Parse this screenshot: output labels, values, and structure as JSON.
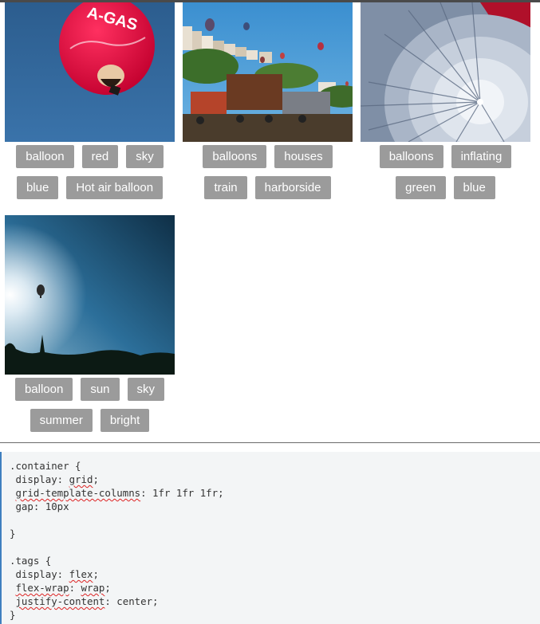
{
  "gallery": {
    "items": [
      {
        "image": "hot-air-balloon-closeup",
        "image_text": "A-GAS",
        "tags": [
          "balloon",
          "red",
          "sky",
          "blue",
          "Hot air balloon"
        ]
      },
      {
        "image": "balloons-over-train-and-houses",
        "tags": [
          "balloons",
          "houses",
          "train",
          "harborside"
        ]
      },
      {
        "image": "balloon-inflating",
        "tags": [
          "balloons",
          "inflating",
          "green",
          "blue"
        ]
      },
      {
        "image": "balloon-in-sun",
        "tags": [
          "balloon",
          "sun",
          "sky",
          "summer",
          "bright"
        ]
      }
    ]
  },
  "css_code": {
    "lines": [
      [
        {
          "t": ".container {"
        }
      ],
      [
        {
          "t": " display: "
        },
        {
          "t": "grid",
          "sq": true
        },
        {
          "t": ";"
        }
      ],
      [
        {
          "t": " "
        },
        {
          "t": "grid-template-columns",
          "sq": true
        },
        {
          "t": ": 1fr 1fr 1fr;"
        }
      ],
      [
        {
          "t": " gap: 10px"
        }
      ],
      [
        {
          "t": ""
        }
      ],
      [
        {
          "t": "}"
        }
      ],
      [
        {
          "t": ""
        }
      ],
      [
        {
          "t": ".tags {"
        }
      ],
      [
        {
          "t": " display: "
        },
        {
          "t": "flex",
          "sq": true
        },
        {
          "t": ";"
        }
      ],
      [
        {
          "t": " "
        },
        {
          "t": "flex-wrap",
          "sq": true
        },
        {
          "t": ": "
        },
        {
          "t": "wrap",
          "sq": true
        },
        {
          "t": ";"
        }
      ],
      [
        {
          "t": " "
        },
        {
          "t": "justify-content",
          "sq": true
        },
        {
          "t": ": center;"
        }
      ],
      [
        {
          "t": "}"
        }
      ]
    ]
  }
}
